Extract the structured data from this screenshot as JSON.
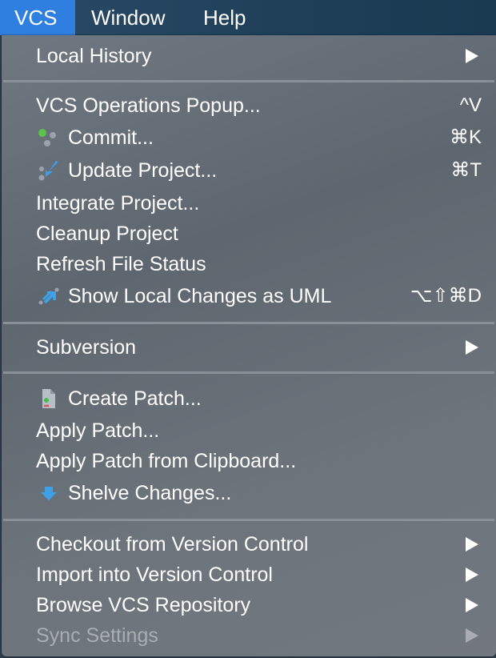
{
  "menubar": {
    "vcs": "VCS",
    "window": "Window",
    "help": "Help"
  },
  "menu": {
    "local_history": "Local History",
    "vcs_operations_popup": {
      "label": "VCS Operations Popup...",
      "shortcut": "^V"
    },
    "commit": {
      "label": "Commit...",
      "shortcut": "⌘K",
      "icon": "commit-icon"
    },
    "update_project": {
      "label": "Update Project...",
      "shortcut": "⌘T",
      "icon": "update-project-icon"
    },
    "integrate_project": "Integrate Project...",
    "cleanup_project": "Cleanup Project",
    "refresh_file_status": "Refresh File Status",
    "show_local_changes_uml": {
      "label": "Show Local Changes as UML",
      "shortcut": "⌥⇧⌘D",
      "icon": "uml-icon"
    },
    "subversion": "Subversion",
    "create_patch": {
      "label": "Create Patch...",
      "icon": "create-patch-icon"
    },
    "apply_patch": "Apply Patch...",
    "apply_patch_clipboard": "Apply Patch from Clipboard...",
    "shelve_changes": {
      "label": "Shelve Changes...",
      "icon": "shelve-icon"
    },
    "checkout": "Checkout from Version Control",
    "import": "Import into Version Control",
    "browse_repository": "Browse VCS Repository",
    "sync_settings": {
      "label": "Sync Settings",
      "disabled": true
    }
  },
  "colors": {
    "menubar_active": "#2f7fe0",
    "menu_background": "#666e77",
    "disabled_text": "#a9adb2"
  }
}
